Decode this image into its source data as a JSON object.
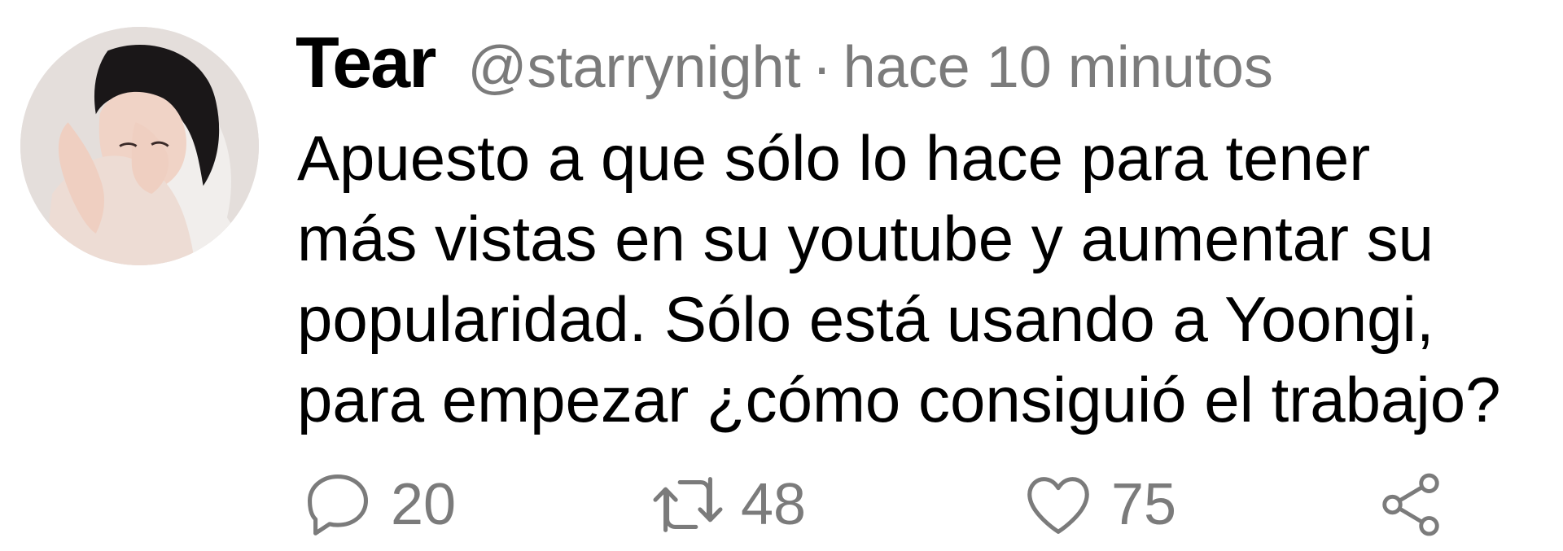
{
  "tweet": {
    "author_name": "Tear",
    "handle": "@starrynight",
    "separator": "·",
    "timestamp": "hace 10 minutos",
    "text_lines": [
      "Apuesto a que sólo lo hace para tener",
      "más vistas en su youtube y aumentar su",
      "popularidad. Sólo está usando a Yoongi,",
      "para empezar ¿cómo consiguió el trabajo?"
    ],
    "actions": {
      "reply": {
        "icon": "reply-icon",
        "count": "20"
      },
      "retweet": {
        "icon": "retweet-icon",
        "count": "48"
      },
      "like": {
        "icon": "heart-icon",
        "count": "75"
      },
      "share": {
        "icon": "share-icon"
      }
    }
  },
  "colors": {
    "text": "#000000",
    "muted": "#7b7b7b",
    "background": "#ffffff"
  }
}
